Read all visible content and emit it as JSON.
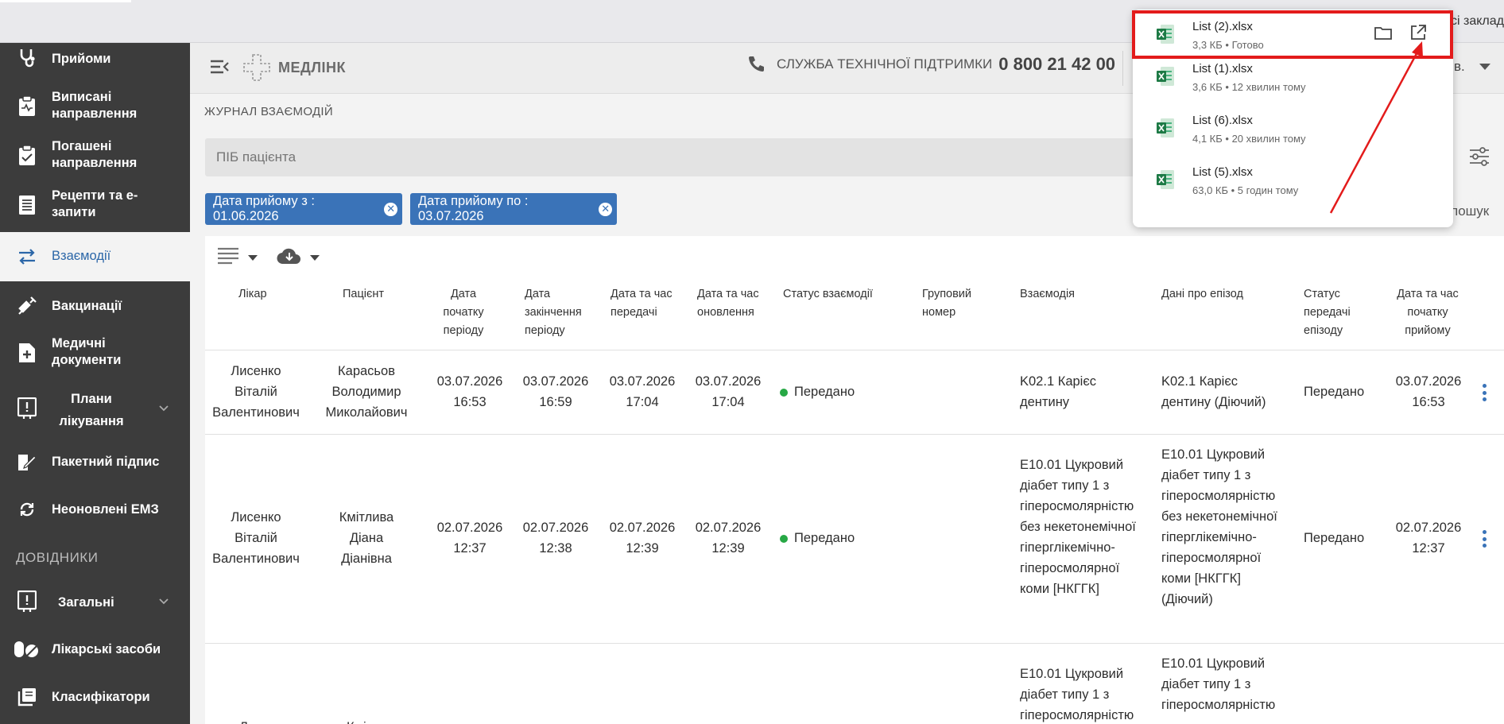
{
  "browser": {
    "right_text": "сі заклад"
  },
  "app": {
    "logo_text": "МЕДЛІНК",
    "support_label": "СЛУЖБА ТЕХНІЧНОЇ ПІДТРИМКИ",
    "support_phone": "0 800 21 42 00",
    "user_tail": "в."
  },
  "sidebar": {
    "items": [
      {
        "label": "Прийоми",
        "icon": "stethoscope-icon"
      },
      {
        "label": "Виписані направлення",
        "icon": "clipboard-pulse-icon"
      },
      {
        "label": "Погашені направлення",
        "icon": "clipboard-check-icon"
      },
      {
        "label": "Рецепти та е-запити",
        "icon": "document-list-icon"
      },
      {
        "label": "Взаємодії",
        "icon": "swap-arrows-icon"
      },
      {
        "label": "Вакцинації",
        "icon": "syringe-icon"
      },
      {
        "label": "Медичні документи",
        "icon": "document-plus-icon"
      },
      {
        "label": "Плани лікування",
        "icon": "plan-board-icon"
      },
      {
        "label": "Пакетний підпис",
        "icon": "signature-icon"
      },
      {
        "label": "Неоновлені ЕМЗ",
        "icon": "refresh-icon"
      }
    ],
    "section_title": "ДОВІДНИКИ",
    "ref_items": [
      {
        "label": "Загальні",
        "icon": "plan-board-icon"
      },
      {
        "label": "Лікарські засоби",
        "icon": "pills-icon"
      },
      {
        "label": "Класифікатори",
        "icon": "library-icon"
      }
    ]
  },
  "page": {
    "title": "ЖУРНАЛ ВЗАЄМОДІЙ",
    "search_placeholder": "ПІБ пацієнта",
    "search_tail": "пошук",
    "chips": [
      {
        "label": "Дата прийому з : 01.06.2026"
      },
      {
        "label": "Дата прийому по : 03.07.2026"
      }
    ]
  },
  "table": {
    "headers": {
      "doctor": "Лікар",
      "patient": "Пацієнт",
      "period_start": "Дата початку періоду",
      "period_end": "Дата закінчення періоду",
      "sent_at": "Дата та час передачі",
      "updated_at": "Дата та час оновлення",
      "status": "Статус взаємодії",
      "group_number": "Груповий номер",
      "interaction": "Взаємодія",
      "episode": "Дані про епізод",
      "episode_status": "Статус передачі епізоду",
      "visit_start": "Дата та час початку прийому"
    },
    "rows": [
      {
        "doctor": "Лисенко Віталій Валентинович",
        "patient": "Карасьов Володимир Миколайович",
        "period_start": "03.07.2026 16:53",
        "period_end": "03.07.2026 16:59",
        "sent_at": "03.07.2026 17:04",
        "updated_at": "03.07.2026 17:04",
        "status": "Передано",
        "group_number": "",
        "interaction": "K02.1 Карієс дентину",
        "episode": "K02.1 Карієс дентину (Діючий)",
        "episode_status": "Передано",
        "visit_start": "03.07.2026 16:53"
      },
      {
        "doctor": "Лисенко Віталій Валентинович",
        "patient": "Кмітлива Діана Діанівна",
        "period_start": "02.07.2026 12:37",
        "period_end": "02.07.2026 12:38",
        "sent_at": "02.07.2026 12:39",
        "updated_at": "02.07.2026 12:39",
        "status": "Передано",
        "group_number": "",
        "interaction": "E10.01 Цукровий діабет типу 1 з гіперосмолярністю без некетонемічної гіперглікемічно-гіперосмолярної коми [НКГГК]",
        "episode": "E10.01 Цукровий діабет типу 1 з гіперосмолярністю без некетонемічної гіперглікемічно-гіперосмолярної коми [НКГГК] (Діючий)",
        "episode_status": "Передано",
        "visit_start": "02.07.2026 12:37"
      },
      {
        "doctor": "Л",
        "patient": "Кмі",
        "interaction": "E10.01 Цукровий діабет типу 1 з гіперосмолярністю",
        "episode": "E10.01 Цукровий діабет типу 1 з гіперосмолярністю"
      }
    ]
  },
  "downloads": {
    "items": [
      {
        "name": "List (2).xlsx",
        "meta": "3,3 КБ • Готово"
      },
      {
        "name": "List (1).xlsx",
        "meta": "3,6 КБ • 12 хвилин тому"
      },
      {
        "name": "List (6).xlsx",
        "meta": "4,1 КБ • 20 хвилин тому"
      },
      {
        "name": "List (5).xlsx",
        "meta": "63,0 КБ • 5 годин тому"
      }
    ]
  },
  "colors": {
    "sidebar_bg": "#3c3c3c",
    "accent": "#3a73b8",
    "status_ok": "#27a845",
    "annotation": "#e31b1b"
  }
}
